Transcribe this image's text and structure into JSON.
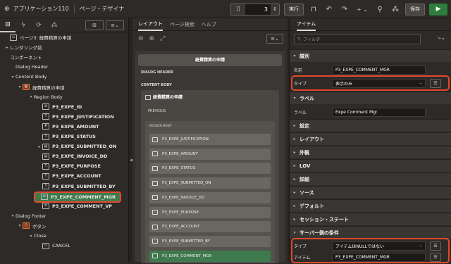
{
  "topbar": {
    "app_label": "アプリケーション110",
    "designer_label": "ページ・デザイナ",
    "page_number": "3",
    "run_label": "実行",
    "save_label": "保存",
    "add_label": "+ ⌄"
  },
  "left": {
    "tree": [
      {
        "label": "ページ3: 経費精算の申請",
        "icon": "page-icon",
        "level": 0
      },
      {
        "label": "レンダリング前",
        "icon": "none",
        "level": 0
      },
      {
        "label": "コンポーネント",
        "icon": "none",
        "level": 0
      },
      {
        "label": "Dialog Header",
        "icon": "none",
        "level": 1
      },
      {
        "label": "Content Body",
        "icon": "none",
        "level": 1
      },
      {
        "label": "経費精算の申請",
        "icon": "region-icon",
        "level": 2
      },
      {
        "label": "Region Body",
        "icon": "none",
        "level": 3
      },
      {
        "label": "P3_EXPE_ID",
        "icon": "hidden-item-icon",
        "level": 4
      },
      {
        "label": "P3_EXPE_JUSTIFICATION",
        "icon": "text-item-icon",
        "level": 4
      },
      {
        "label": "P3_EXPE_AMOUNT",
        "icon": "number-item-icon",
        "level": 4
      },
      {
        "label": "P3_EXPE_STATUS",
        "icon": "text-item-icon",
        "level": 4
      },
      {
        "label": "P3_EXPE_SUBMITTED_ON",
        "icon": "date-item-icon",
        "level": 4
      },
      {
        "label": "P3_EXPE_INVOICE_DD",
        "icon": "date-item-icon",
        "level": 4
      },
      {
        "label": "P3_EXPE_PURPOSE",
        "icon": "text-item-icon",
        "level": 4
      },
      {
        "label": "P3_EXPE_ACCOUNT",
        "icon": "text-item-icon",
        "level": 4
      },
      {
        "label": "P3_EXPE_SUBMITTED_BY",
        "icon": "text-item-icon",
        "level": 4
      },
      {
        "label": "P3_EXPE_COMMENT_MGR",
        "icon": "textarea-item-icon",
        "level": 4
      },
      {
        "label": "P3_EXPE_COMMENT_VP",
        "icon": "textarea-item-icon",
        "level": 4
      },
      {
        "label": "Dialog Footer",
        "icon": "none",
        "level": 1
      },
      {
        "label": "ボタン",
        "icon": "button-group-icon",
        "level": 2
      },
      {
        "label": "Close",
        "icon": "none",
        "level": 3
      },
      {
        "label": "CANCEL",
        "icon": "button-icon",
        "level": 4
      }
    ]
  },
  "middle": {
    "tabs": [
      "レイアウト",
      "ページ検索",
      "ヘルプ"
    ],
    "region_title": "経費精算の申請",
    "dialog_header": "DIALOG HEADER",
    "content_body": "CONTENT BODY",
    "inner_region_title": "経費精算の申請",
    "previous": "PREVIOUS",
    "region_body": "REGION BODY",
    "items": [
      "P3_EXPE_JUSTIFICATION",
      "P3_EXPE_AMOUNT",
      "P3_EXPE_STATUS",
      "P3_EXPE_SUBMITTED_ON",
      "P3_EXPE_INVOICE_DD",
      "P3_EXPE_PURPOSE",
      "P3_EXPE_ACCOUNT",
      "P3_EXPE_SUBMITTED_BY",
      "P3_EXPE_COMMENT_MGR"
    ]
  },
  "right": {
    "tab": "アイテム",
    "filter_placeholder": "フィルタ",
    "sections": {
      "identification": "識別",
      "label": "ラベル",
      "settings": "設定",
      "layout": "レイアウト",
      "appearance": "外観",
      "lov": "LOV",
      "advanced": "詳細",
      "source": "ソース",
      "default": "デフォルト",
      "session_state": "セッション・ステート",
      "server_condition": "サーバー側の条件"
    },
    "fields": {
      "name_label": "名前",
      "name_value": "P3_EXPE_COMMENT_MGR",
      "type_label": "タイプ",
      "type_value": "表示のみ",
      "label_label": "ラベル",
      "label_value": "Expe Comment Mgr",
      "cond_type_label": "タイプ",
      "cond_type_value": "アイテムはNULLではない",
      "cond_item_label": "アイテム",
      "cond_item_value": "P3_EXPE_COMMENT_MGR"
    }
  },
  "colors": {
    "highlight": "#e04a2a",
    "selected": "#3f7a4e",
    "run": "#2f7d3c"
  }
}
